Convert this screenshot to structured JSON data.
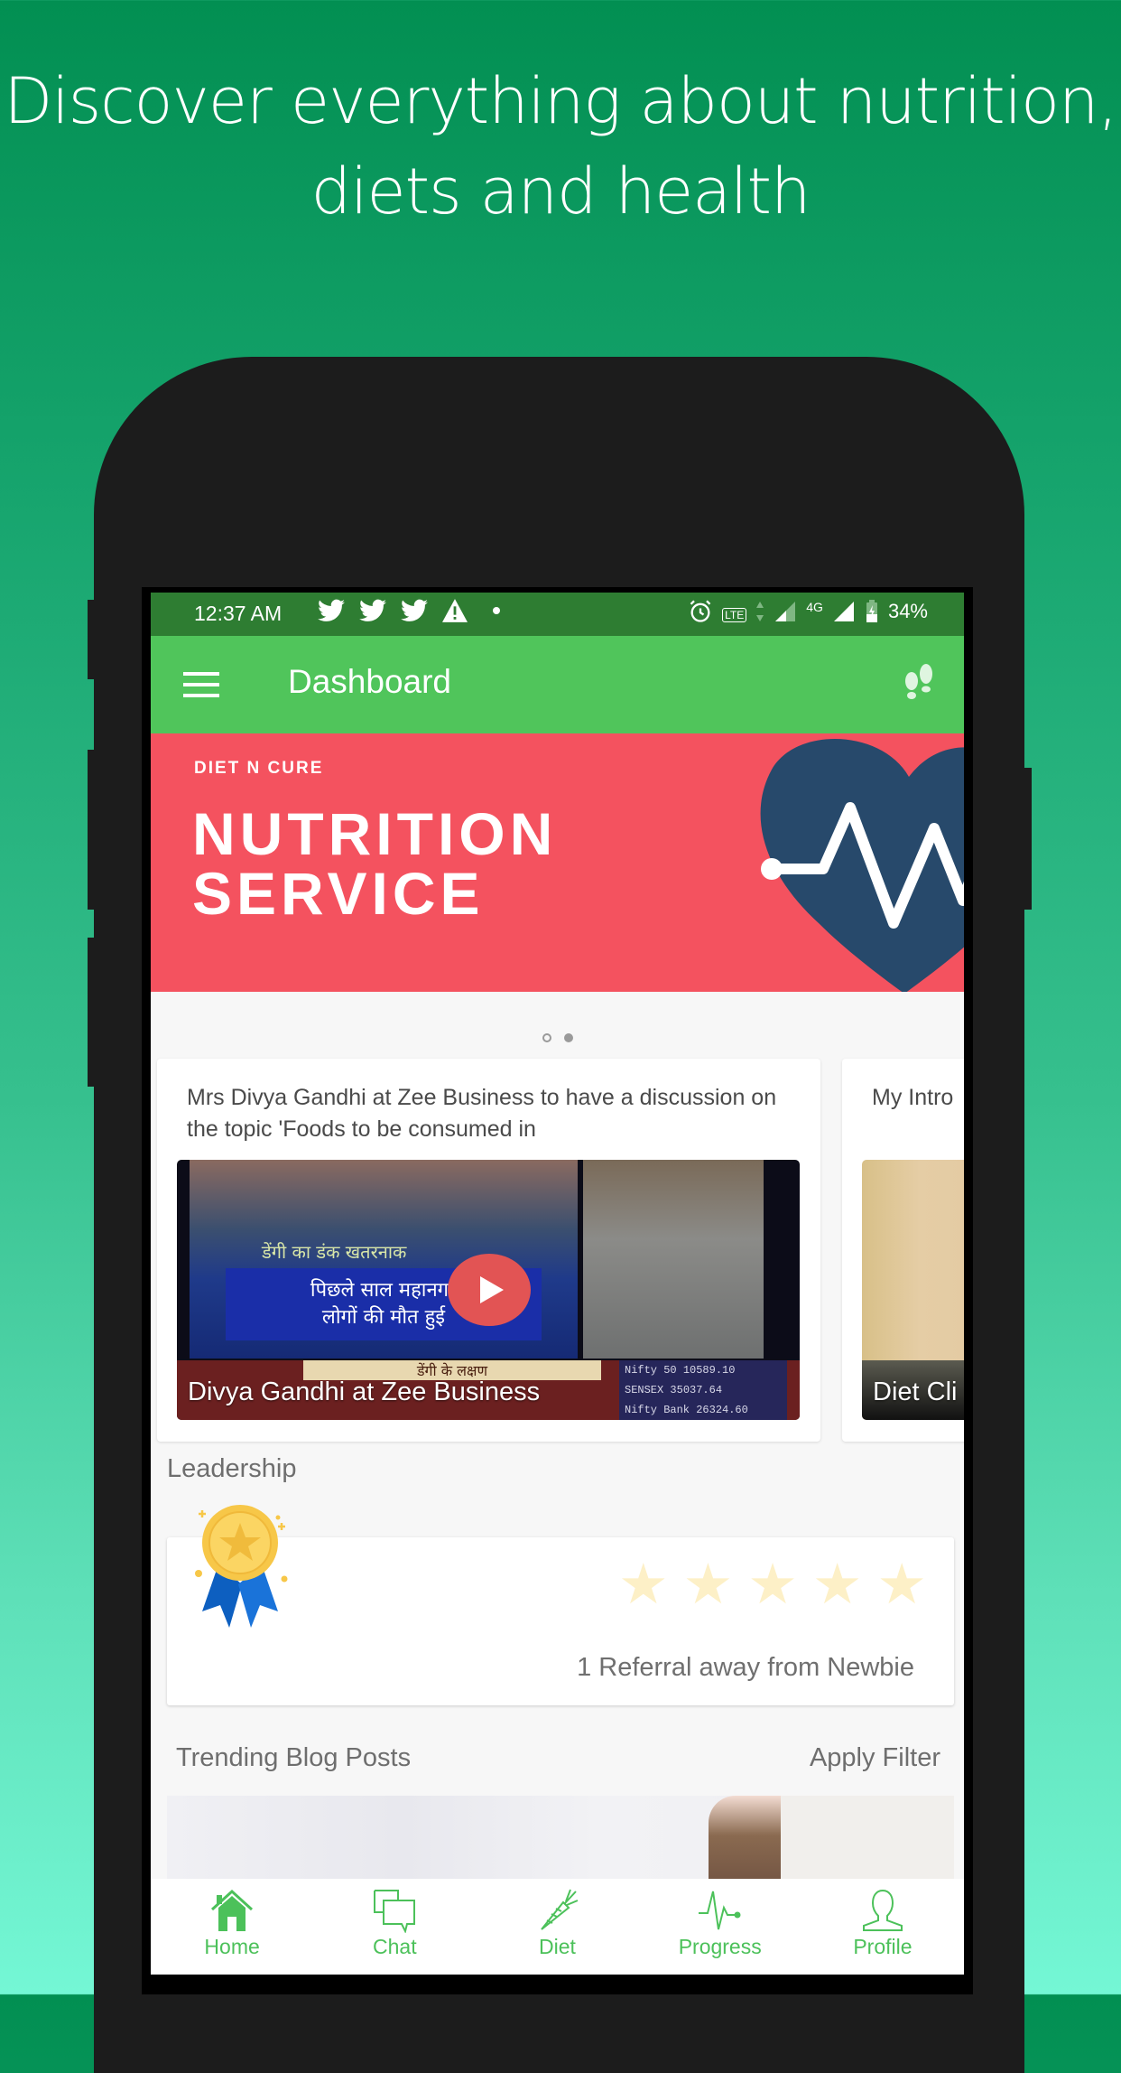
{
  "promo": {
    "headline_line1": "Discover everything about nutrition,",
    "headline_line2": "diets and health",
    "background_top": "#028f52",
    "background_bottom": "#74f7d5"
  },
  "status_bar": {
    "time": "12:37 AM",
    "notification_icons": [
      "twitter-icon",
      "twitter-icon",
      "twitter-icon",
      "warning-icon",
      "dot-icon"
    ],
    "system_icons": [
      "alarm-icon",
      "volte-icon",
      "data-arrows-icon",
      "signal-x-icon",
      "4g-signal-icon",
      "battery-charging-icon"
    ],
    "network": "4G",
    "volte": "VoLTE",
    "battery": "34%"
  },
  "app_bar": {
    "title": "Dashboard",
    "menu_icon": "hamburger-menu-icon",
    "action_icon": "footsteps-icon",
    "color": "#50c55b"
  },
  "banner": {
    "brand": "DIET N CURE",
    "title_line1": "NUTRITION",
    "title_line2": "SERVICE",
    "background": "#f4525f",
    "heart_color": "#27496b",
    "page_count": 2,
    "active_page": 2
  },
  "videos": [
    {
      "title": "Mrs Divya Gandhi at Zee Business to have a discussion on the topic 'Foods to be consumed in",
      "caption": "Divya Gandhi at Zee Business",
      "tv_text_1": "डेंगी का डंक खतरनाक",
      "tv_text_2": "पिछले साल महानगर",
      "tv_text_3": "लोगों की मौत हुई",
      "ticker_1_label": "Nifty 50",
      "ticker_1_value": "10589.10",
      "ticker_2_label": "SENSEX",
      "ticker_2_value": "35037.64",
      "ticker_3_label": "Nifty Bank",
      "ticker_3_value": "26324.60",
      "lower_banner": "डेंगी के लक्षण"
    },
    {
      "title": "My Intro",
      "caption": "Diet Cli"
    }
  ],
  "leadership": {
    "label": "Leadership",
    "stars_total": 5,
    "stars_filled": 0,
    "referral_text": "1 Referral away from Newbie"
  },
  "blog": {
    "section_title": "Trending Blog Posts",
    "filter_label": "Apply Filter"
  },
  "bottom_nav": {
    "active_color": "#4cc15a",
    "items": [
      {
        "label": "Home",
        "icon": "home-icon",
        "active": true
      },
      {
        "label": "Chat",
        "icon": "chat-icon"
      },
      {
        "label": "Diet",
        "icon": "carrot-icon"
      },
      {
        "label": "Progress",
        "icon": "pulse-icon"
      },
      {
        "label": "Profile",
        "icon": "user-icon"
      }
    ]
  }
}
